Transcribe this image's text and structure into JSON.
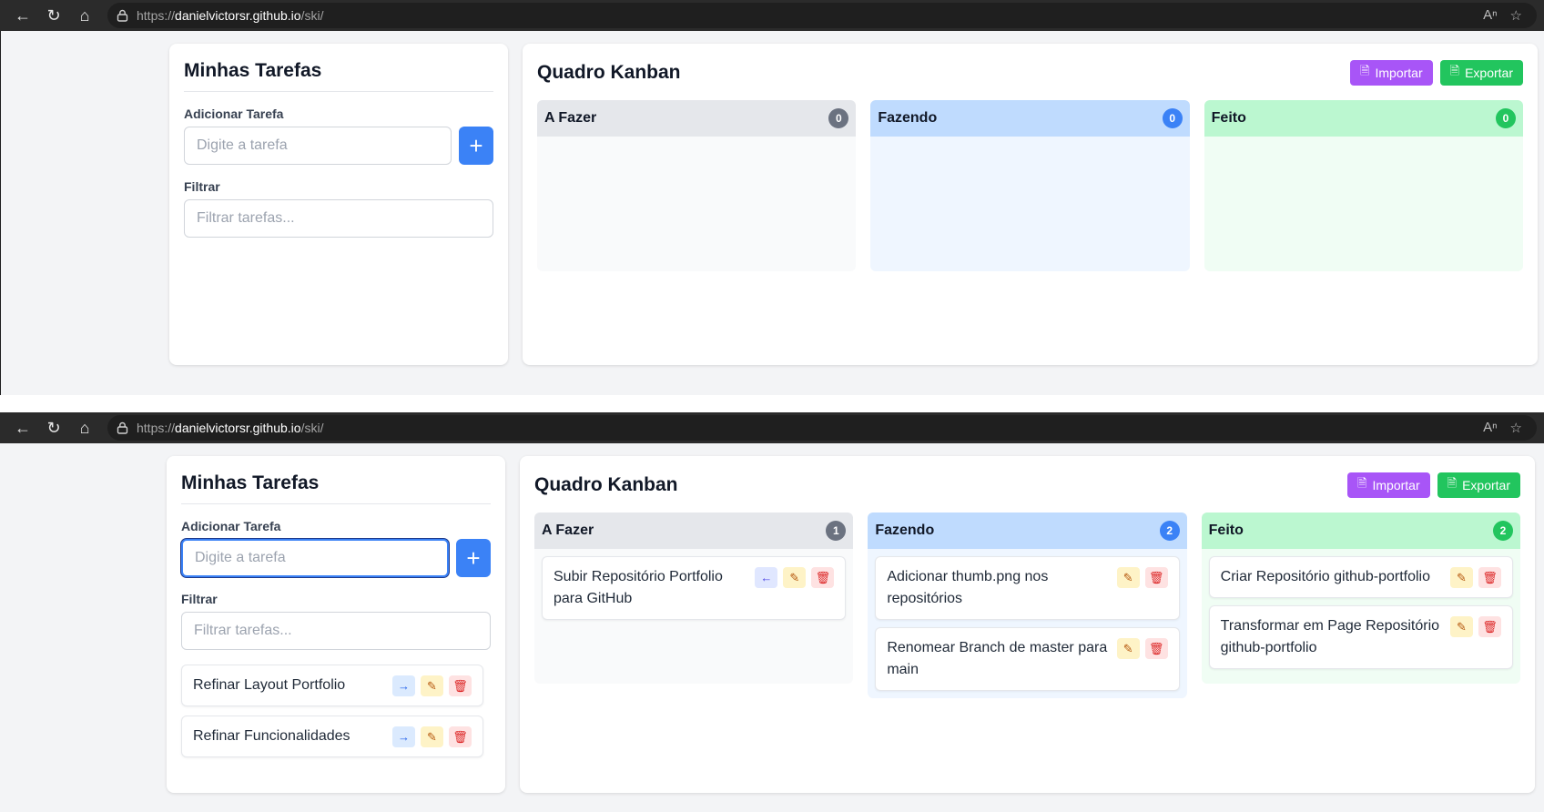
{
  "browser": {
    "url_prefix": "https://",
    "url_host": "danielvictorsr.github.io",
    "url_path": "/ski/"
  },
  "sidebar": {
    "title": "Minhas Tarefas",
    "add_label": "Adicionar Tarefa",
    "add_placeholder": "Digite a tarefa",
    "add_button": "+",
    "filter_label": "Filtrar",
    "filter_placeholder": "Filtrar tarefas..."
  },
  "board": {
    "title": "Quadro Kanban",
    "import_label": "Importar",
    "export_label": "Exportar"
  },
  "screen1": {
    "columns": [
      {
        "name": "A Fazer",
        "count": "0",
        "tasks": []
      },
      {
        "name": "Fazendo",
        "count": "0",
        "tasks": []
      },
      {
        "name": "Feito",
        "count": "0",
        "tasks": []
      }
    ]
  },
  "screen2": {
    "loose_tasks": [
      "Refinar Layout Portfolio",
      "Refinar Funcionalidades"
    ],
    "columns": [
      {
        "name": "A Fazer",
        "count": "1",
        "tasks": [
          "Subir Repositório Portfolio para GitHub"
        ]
      },
      {
        "name": "Fazendo",
        "count": "2",
        "tasks": [
          "Adicionar thumb.png nos repositórios",
          "Renomear Branch de master para main"
        ]
      },
      {
        "name": "Feito",
        "count": "2",
        "tasks": [
          "Criar Repositório github-portfolio",
          "Transformar em Page Repositório github-portfolio"
        ]
      }
    ]
  },
  "icons": {
    "move_right": "arrow-right-icon",
    "move_left": "arrow-left-icon",
    "edit": "edit-icon",
    "delete": "trash-icon",
    "import": "file-import-icon",
    "export": "file-export-icon"
  },
  "colors": {
    "primary": "#3b82f6",
    "import": "#a855f7",
    "export": "#22c55e",
    "todo_head": "#e5e7eb",
    "doing_head": "#bfdbfe",
    "done_head": "#bbf7d0"
  }
}
